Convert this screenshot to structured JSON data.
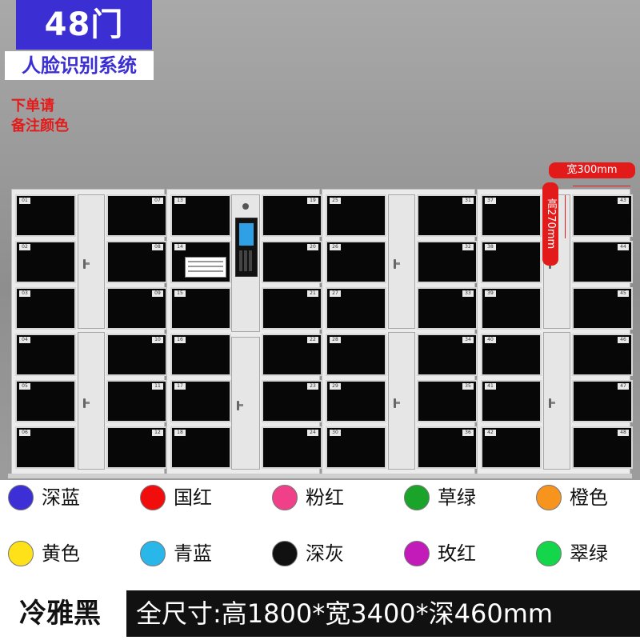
{
  "badge": {
    "count": "48门",
    "title": "人脸识别系统"
  },
  "note": {
    "line1": "下单请",
    "line2": "备注颜色"
  },
  "dimensions": {
    "width": "宽300mm",
    "height": "高270mm"
  },
  "cabinets": [
    {
      "left_nums": [
        "01",
        "02",
        "03",
        "04",
        "05",
        "06"
      ],
      "right_nums": [
        "07",
        "08",
        "09",
        "10",
        "11",
        "12"
      ]
    },
    {
      "left_nums": [
        "13",
        "14",
        "15",
        "16",
        "17",
        "18"
      ],
      "right_nums": [
        "19",
        "20",
        "21",
        "22",
        "23",
        "24"
      ]
    },
    {
      "left_nums": [
        "25",
        "26",
        "27",
        "28",
        "29",
        "30"
      ],
      "right_nums": [
        "31",
        "32",
        "33",
        "34",
        "35",
        "36"
      ]
    },
    {
      "left_nums": [
        "37",
        "38",
        "39",
        "40",
        "41",
        "42"
      ],
      "right_nums": [
        "43",
        "44",
        "45",
        "46",
        "47",
        "48"
      ]
    }
  ],
  "colors": [
    {
      "name": "深蓝",
      "hex": "#3d2fd6"
    },
    {
      "name": "国红",
      "hex": "#f20d0d"
    },
    {
      "name": "粉红",
      "hex": "#f0408a"
    },
    {
      "name": "草绿",
      "hex": "#1aa52a"
    },
    {
      "name": "橙色",
      "hex": "#f7941d"
    },
    {
      "name": "黄色",
      "hex": "#ffe11a"
    },
    {
      "name": "青蓝",
      "hex": "#29b6e8"
    },
    {
      "name": "深灰",
      "hex": "#111111"
    },
    {
      "name": "玫红",
      "hex": "#c21bb9"
    },
    {
      "name": "翠绿",
      "hex": "#14d64a"
    }
  ],
  "footer": {
    "finish": "冷雅黑",
    "size": "全尺寸:高1800*宽3400*深460mm"
  }
}
